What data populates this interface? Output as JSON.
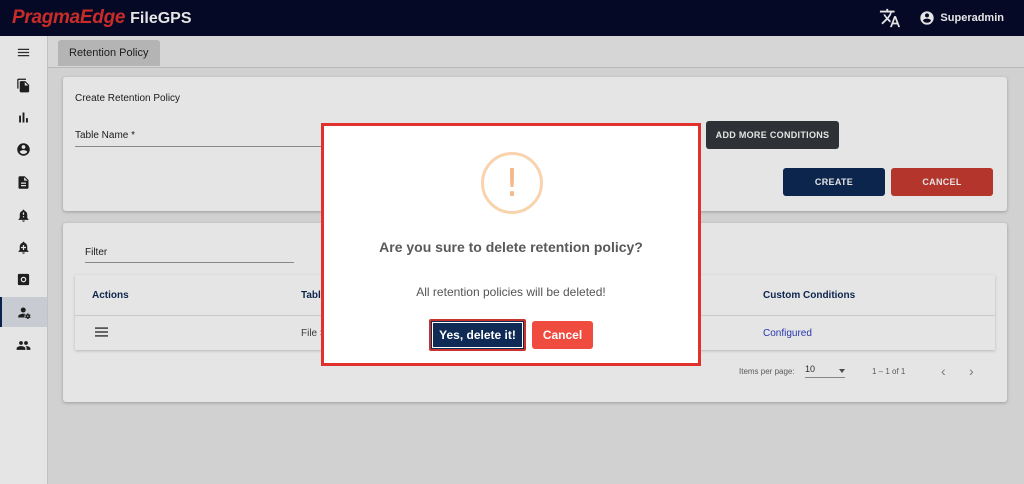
{
  "app": {
    "brand_primary": "PragmaEdge",
    "brand_product": "FileGPS",
    "user_name": "Superadmin",
    "colors": {
      "topbar": "#070b2a",
      "brand_red": "#e0312d",
      "navy": "#0e2a55",
      "danger": "#c93b32"
    }
  },
  "sidebar": {
    "items": [
      {
        "icon": "menu-icon"
      },
      {
        "icon": "files-icon"
      },
      {
        "icon": "bar-chart-icon"
      },
      {
        "icon": "account-circle-icon"
      },
      {
        "icon": "document-icon"
      },
      {
        "icon": "bell-alert-icon"
      },
      {
        "icon": "bell-add-icon"
      },
      {
        "icon": "settings-box-icon"
      },
      {
        "icon": "user-settings-icon",
        "active": true
      },
      {
        "icon": "group-icon"
      }
    ]
  },
  "tabs": {
    "active_label": "Retention Policy"
  },
  "create_form": {
    "title": "Create Retention Policy",
    "table_name_label": "Table Name *",
    "add_conditions_label": "ADD MORE CONDITIONS",
    "create_label": "CREATE",
    "cancel_label": "CANCEL"
  },
  "list": {
    "filter_label": "Filter",
    "columns": [
      "Actions",
      "Table",
      "Custom Conditions"
    ],
    "rows": [
      {
        "table": "File S",
        "custom_conditions": "Configured"
      }
    ],
    "paginator": {
      "items_per_page_label": "Items per page:",
      "page_size": "10",
      "range": "1 – 1 of 1"
    }
  },
  "dialog": {
    "icon": "exclamation-icon",
    "title": "Are you sure to delete retention policy?",
    "text": "All retention policies will be deleted!",
    "confirm_label": "Yes, delete it!",
    "cancel_label": "Cancel"
  }
}
